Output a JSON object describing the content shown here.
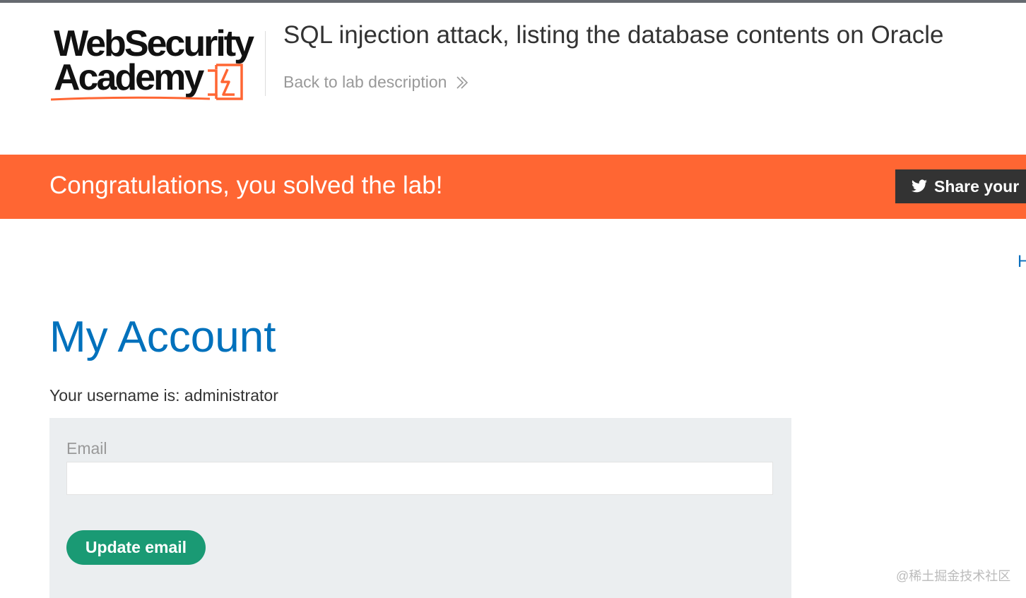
{
  "colors": {
    "brand_orange": "#ff6633",
    "heading_blue": "#0071bc",
    "button_green": "#1a9a74",
    "share_dark": "#333333",
    "panel_bg": "#ebeef0"
  },
  "header": {
    "logo_line1": "WebSecurity",
    "logo_line2": "Academy",
    "lab_title": "SQL injection attack, listing the database contents on Oracle",
    "back_link": "Back to lab description",
    "back_icon": "double-chevron-right-icon"
  },
  "banner": {
    "message": "Congratulations, you solved the lab!",
    "share_label": "Share your",
    "share_icon": "twitter-bird-icon"
  },
  "nav": {
    "home_fragment": "H"
  },
  "account": {
    "heading": "My Account",
    "username_line": "Your username is: administrator",
    "email_label": "Email",
    "email_value": "",
    "update_button": "Update email"
  },
  "watermark": "@稀土掘金技术社区"
}
